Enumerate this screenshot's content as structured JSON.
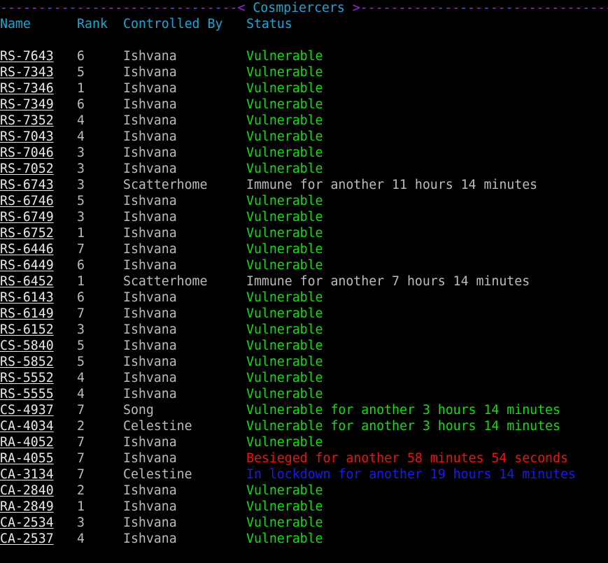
{
  "title": "Cosmpiercers",
  "colors": {
    "rule": "#a020f0",
    "header": "#19a7d8",
    "vulnerable": "#11dd11",
    "immune": "#bcbcbc",
    "besieged": "#ee1111",
    "lockdown": "#1a1aee"
  },
  "columns": {
    "name": "Name",
    "rank": "Rank",
    "controlled_by": "Controlled By",
    "status": "Status"
  },
  "rows": [
    {
      "name": "RS-7643",
      "rank": "6",
      "controlled_by": "Ishvana",
      "status": "Vulnerable",
      "kind": "vuln"
    },
    {
      "name": "RS-7343",
      "rank": "5",
      "controlled_by": "Ishvana",
      "status": "Vulnerable",
      "kind": "vuln"
    },
    {
      "name": "RS-7346",
      "rank": "1",
      "controlled_by": "Ishvana",
      "status": "Vulnerable",
      "kind": "vuln"
    },
    {
      "name": "RS-7349",
      "rank": "6",
      "controlled_by": "Ishvana",
      "status": "Vulnerable",
      "kind": "vuln"
    },
    {
      "name": "RS-7352",
      "rank": "4",
      "controlled_by": "Ishvana",
      "status": "Vulnerable",
      "kind": "vuln"
    },
    {
      "name": "RS-7043",
      "rank": "4",
      "controlled_by": "Ishvana",
      "status": "Vulnerable",
      "kind": "vuln"
    },
    {
      "name": "RS-7046",
      "rank": "3",
      "controlled_by": "Ishvana",
      "status": "Vulnerable",
      "kind": "vuln"
    },
    {
      "name": "RS-7052",
      "rank": "3",
      "controlled_by": "Ishvana",
      "status": "Vulnerable",
      "kind": "vuln"
    },
    {
      "name": "RS-6743",
      "rank": "3",
      "controlled_by": "Scatterhome",
      "status": "Immune for another 11 hours 14 minutes",
      "kind": "immune"
    },
    {
      "name": "RS-6746",
      "rank": "5",
      "controlled_by": "Ishvana",
      "status": "Vulnerable",
      "kind": "vuln"
    },
    {
      "name": "RS-6749",
      "rank": "3",
      "controlled_by": "Ishvana",
      "status": "Vulnerable",
      "kind": "vuln"
    },
    {
      "name": "RS-6752",
      "rank": "1",
      "controlled_by": "Ishvana",
      "status": "Vulnerable",
      "kind": "vuln"
    },
    {
      "name": "RS-6446",
      "rank": "7",
      "controlled_by": "Ishvana",
      "status": "Vulnerable",
      "kind": "vuln"
    },
    {
      "name": "RS-6449",
      "rank": "6",
      "controlled_by": "Ishvana",
      "status": "Vulnerable",
      "kind": "vuln"
    },
    {
      "name": "RS-6452",
      "rank": "1",
      "controlled_by": "Scatterhome",
      "status": "Immune for another 7 hours 14 minutes",
      "kind": "immune"
    },
    {
      "name": "RS-6143",
      "rank": "6",
      "controlled_by": "Ishvana",
      "status": "Vulnerable",
      "kind": "vuln"
    },
    {
      "name": "RS-6149",
      "rank": "7",
      "controlled_by": "Ishvana",
      "status": "Vulnerable",
      "kind": "vuln"
    },
    {
      "name": "RS-6152",
      "rank": "3",
      "controlled_by": "Ishvana",
      "status": "Vulnerable",
      "kind": "vuln"
    },
    {
      "name": "CS-5840",
      "rank": "5",
      "controlled_by": "Ishvana",
      "status": "Vulnerable",
      "kind": "vuln"
    },
    {
      "name": "RS-5852",
      "rank": "5",
      "controlled_by": "Ishvana",
      "status": "Vulnerable",
      "kind": "vuln"
    },
    {
      "name": "RS-5552",
      "rank": "4",
      "controlled_by": "Ishvana",
      "status": "Vulnerable",
      "kind": "vuln"
    },
    {
      "name": "RS-5555",
      "rank": "4",
      "controlled_by": "Ishvana",
      "status": "Vulnerable",
      "kind": "vuln"
    },
    {
      "name": "CS-4937",
      "rank": "7",
      "controlled_by": "Song",
      "status": "Vulnerable for another 3 hours 14 minutes",
      "kind": "vuln"
    },
    {
      "name": "CA-4034",
      "rank": "2",
      "controlled_by": "Celestine",
      "status": "Vulnerable for another 3 hours 14 minutes",
      "kind": "vuln"
    },
    {
      "name": "RA-4052",
      "rank": "7",
      "controlled_by": "Ishvana",
      "status": "Vulnerable",
      "kind": "vuln"
    },
    {
      "name": "RA-4055",
      "rank": "7",
      "controlled_by": "Ishvana",
      "status": "Besieged for another 58 minutes 54 seconds",
      "kind": "siege"
    },
    {
      "name": "CA-3134",
      "rank": "7",
      "controlled_by": "Celestine",
      "status": "In lockdown for another 19 hours 14 minutes",
      "kind": "lock"
    },
    {
      "name": "CA-2840",
      "rank": "2",
      "controlled_by": "Ishvana",
      "status": "Vulnerable",
      "kind": "vuln"
    },
    {
      "name": "RA-2849",
      "rank": "1",
      "controlled_by": "Ishvana",
      "status": "Vulnerable",
      "kind": "vuln"
    },
    {
      "name": "CA-2534",
      "rank": "3",
      "controlled_by": "Ishvana",
      "status": "Vulnerable",
      "kind": "vuln"
    },
    {
      "name": "CA-2537",
      "rank": "4",
      "controlled_by": "Ishvana",
      "status": "Vulnerable",
      "kind": "vuln"
    }
  ]
}
